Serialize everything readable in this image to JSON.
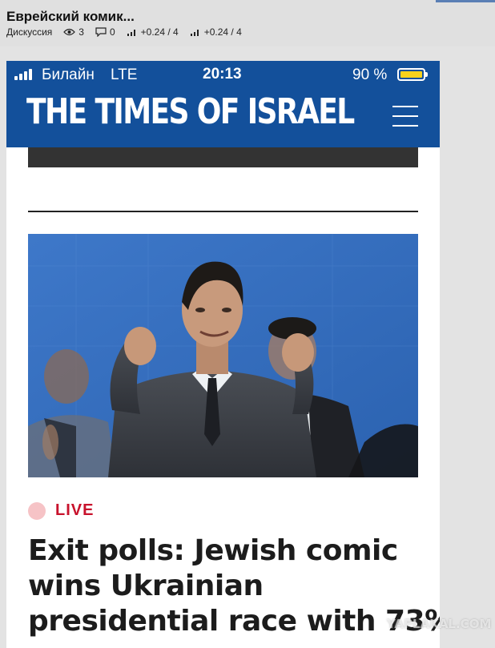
{
  "post": {
    "title": "Еврейский комик...",
    "category": "Дискуссия",
    "views": "3",
    "comments": "0",
    "rating1": "+0.24 / 4",
    "rating2": "+0.24 / 4"
  },
  "phone_status": {
    "carrier": "Билайн",
    "network": "LTE",
    "time": "20:13",
    "battery": "90 %",
    "battery_color": "#f7d21c",
    "battery_level": 0.9
  },
  "site": {
    "masthead": "THE TIMES OF ISRAEL",
    "brand_color": "#13509b"
  },
  "article": {
    "live_label": "LIVE",
    "live_color": "#c8122c",
    "headline": [
      "Exit polls: Jewish comic",
      "wins Ukrainian",
      "presidential race with 73%"
    ]
  },
  "watermark": "YAPLAKAL.COM"
}
